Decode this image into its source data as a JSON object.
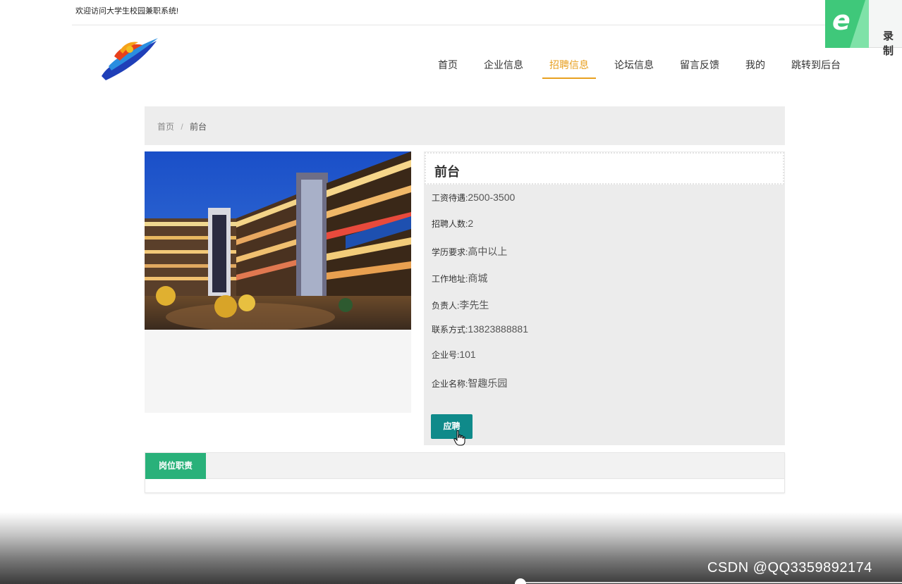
{
  "topbar": {
    "welcome": "欢迎访问大学生校园兼职系统!"
  },
  "recorder": {
    "label": "录制",
    "icon": "ie-e-icon"
  },
  "nav": {
    "items": [
      {
        "label": "首页"
      },
      {
        "label": "企业信息"
      },
      {
        "label": "招聘信息",
        "active": true
      },
      {
        "label": "论坛信息"
      },
      {
        "label": "留言反馈"
      },
      {
        "label": "我的"
      },
      {
        "label": "跳转到后台"
      }
    ],
    "active_color": "#e8a020"
  },
  "breadcrumb": {
    "home": "首页",
    "separator": "/",
    "current": "前台"
  },
  "job": {
    "title": "前台",
    "fields": [
      {
        "label": "工资待遇:",
        "value": "2500-3500"
      },
      {
        "label": "招聘人数:",
        "value": "2"
      },
      {
        "label": "学历要求:",
        "value": "高中以上"
      },
      {
        "label": "工作地址:",
        "value": "商城"
      },
      {
        "label": "负责人:",
        "value": "李先生"
      },
      {
        "label": "联系方式:",
        "value": "13823888881"
      },
      {
        "label": "企业号:",
        "value": "101"
      },
      {
        "label": "企业名称:",
        "value": "智趣乐园"
      }
    ],
    "apply_label": "应聘",
    "apply_color": "#0f8a8a"
  },
  "tabs": {
    "duty_label": "岗位职责",
    "tab_color": "#29b17a"
  },
  "watermark": "CSDN @QQ3359892174"
}
